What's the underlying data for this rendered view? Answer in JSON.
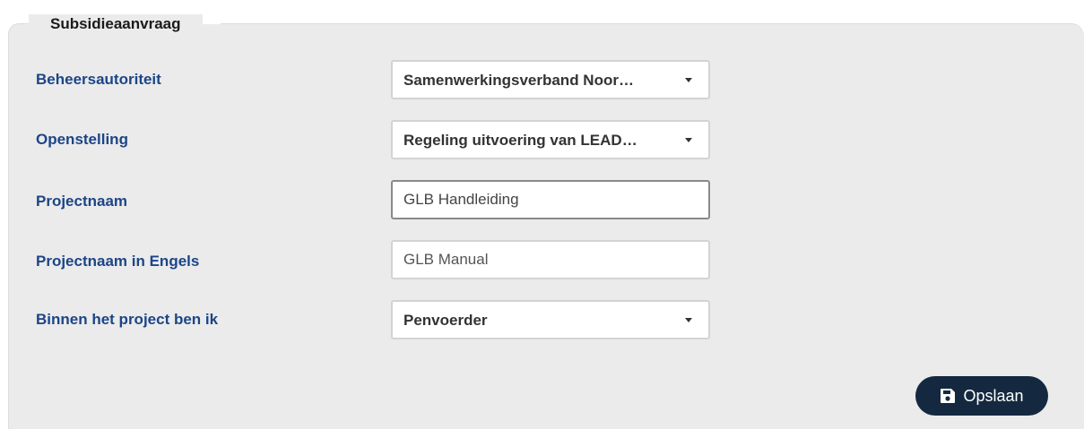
{
  "form": {
    "legend": "Subsidieaanvraag",
    "fields": [
      {
        "label": "Beheersautoriteit",
        "type": "select",
        "value": "Samenwerkingsverband Noor…"
      },
      {
        "label": "Openstelling",
        "type": "select",
        "value": "Regeling uitvoering van LEAD…"
      },
      {
        "label": "Projectnaam",
        "type": "text",
        "value": "GLB Handleiding"
      },
      {
        "label": "Projectnaam in Engels",
        "type": "text",
        "value": "GLB Manual"
      },
      {
        "label": "Binnen het project ben ik",
        "type": "select",
        "value": "Penvoerder"
      }
    ]
  },
  "actions": {
    "save_label": "Opslaan",
    "save_icon": "floppy-disk-icon",
    "button_color": "#142940"
  },
  "colors": {
    "label": "#1c4587",
    "panel": "#ebebeb"
  }
}
